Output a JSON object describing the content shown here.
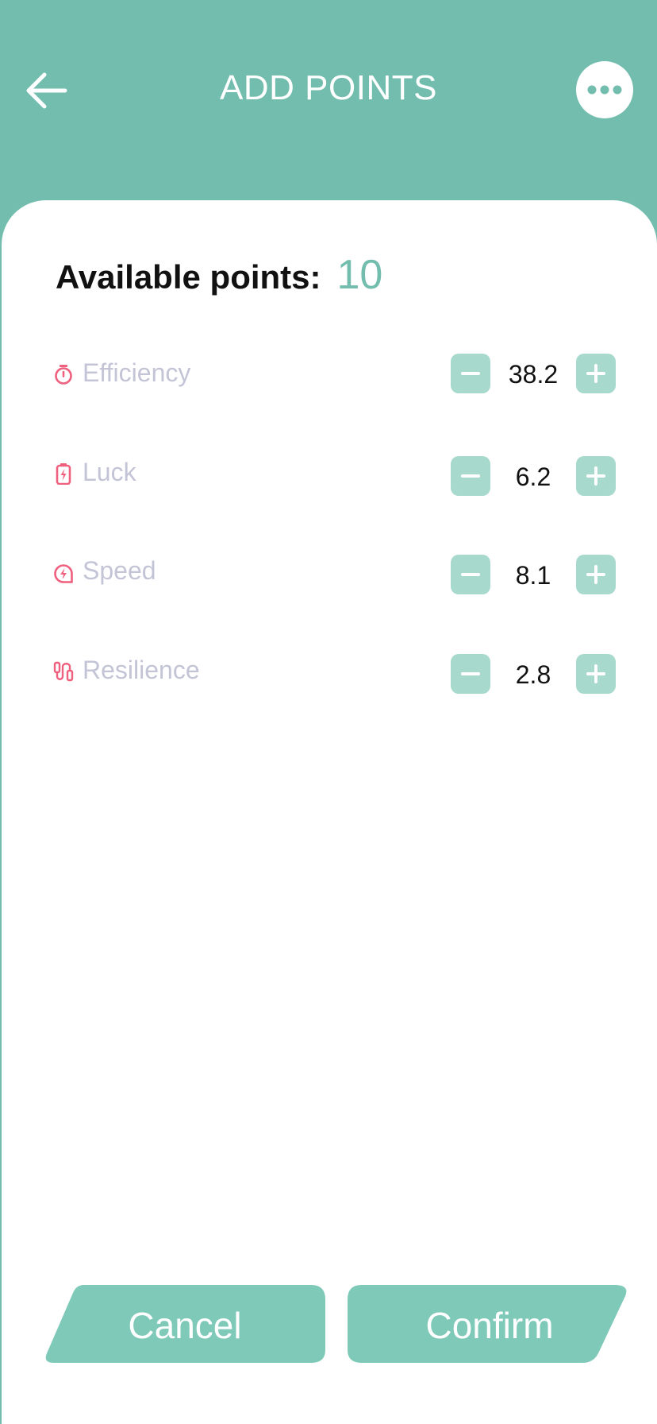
{
  "header": {
    "title": "ADD POINTS"
  },
  "available": {
    "label": "Available points:",
    "value": "10"
  },
  "stats": [
    {
      "name": "Efficiency",
      "value": "38.2",
      "icon": "stopwatch-icon"
    },
    {
      "name": "Luck",
      "value": "6.2",
      "icon": "battery-bolt-icon"
    },
    {
      "name": "Speed",
      "value": "8.1",
      "icon": "lightning-circle-icon"
    },
    {
      "name": "Resilience",
      "value": "2.8",
      "icon": "jump-rope-icon"
    }
  ],
  "footer": {
    "cancel_label": "Cancel",
    "confirm_label": "Confirm"
  },
  "colors": {
    "primary": "#72bdae",
    "button_fill": "#7fc9b9",
    "stepper_fill": "#a8d9cd",
    "icon_accent": "#ef5f7e",
    "stat_label": "#c3c4d6"
  }
}
